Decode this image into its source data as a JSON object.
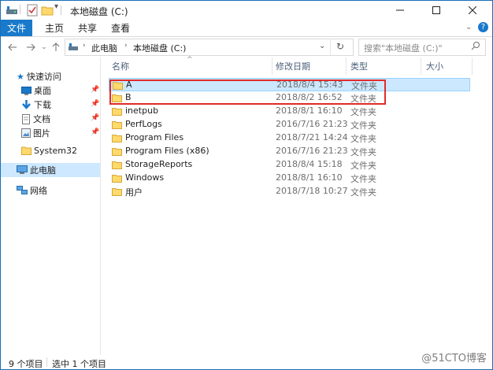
{
  "window": {
    "title": "本地磁盘 (C:)"
  },
  "ribbon": {
    "tabs": [
      "文件",
      "主页",
      "共享",
      "查看"
    ]
  },
  "address": {
    "path": [
      "此电脑",
      "本地磁盘 (C:)"
    ],
    "search_placeholder": "搜索\"本地磁盘 (C:)\""
  },
  "nav": {
    "quick_access": "快速访问",
    "items": [
      "桌面",
      "下载",
      "文档",
      "图片",
      "System32"
    ],
    "this_pc": "此电脑",
    "network": "网络"
  },
  "columns": {
    "name": "名称",
    "date": "修改日期",
    "type": "类型",
    "size": "大小"
  },
  "files": [
    {
      "name": "A",
      "date": "2018/8/4 15:43",
      "type": "文件夹"
    },
    {
      "name": "B",
      "date": "2018/8/2 16:52",
      "type": "文件夹"
    },
    {
      "name": "inetpub",
      "date": "2018/8/1 16:10",
      "type": "文件夹"
    },
    {
      "name": "PerfLogs",
      "date": "2016/7/16 21:23",
      "type": "文件夹"
    },
    {
      "name": "Program Files",
      "date": "2018/7/21 14:24",
      "type": "文件夹"
    },
    {
      "name": "Program Files (x86)",
      "date": "2016/7/16 21:23",
      "type": "文件夹"
    },
    {
      "name": "StorageReports",
      "date": "2018/8/4 15:18",
      "type": "文件夹"
    },
    {
      "name": "Windows",
      "date": "2018/8/1 16:10",
      "type": "文件夹"
    },
    {
      "name": "用户",
      "date": "2018/7/18 10:27",
      "type": "文件夹"
    }
  ],
  "status": {
    "count": "9 个项目",
    "selected": "选中 1 个项目"
  },
  "watermark": "@51CTO博客",
  "colors": {
    "accent": "#1979ca",
    "selection": "#cce8ff",
    "highlight": "#e12b2b",
    "folder": "#ffd96b"
  }
}
